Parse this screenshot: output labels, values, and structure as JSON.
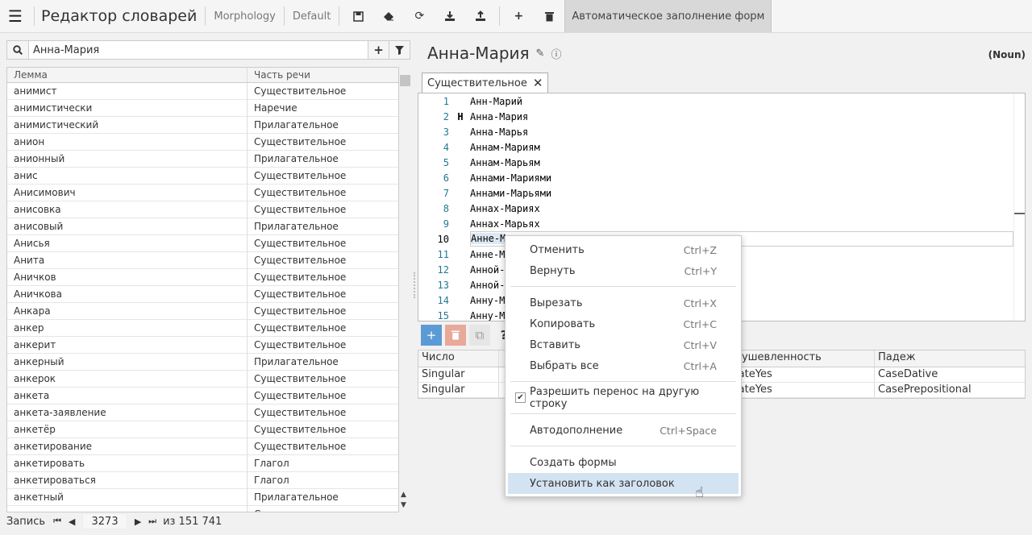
{
  "toolbar": {
    "app_title": "Редактор словарей",
    "module": "Morphology",
    "profile": "Default",
    "autofill_label": "Автоматическое заполнение форм"
  },
  "search": {
    "value": "Анна-Мария"
  },
  "left_table": {
    "columns": [
      "Лемма",
      "Часть речи"
    ],
    "rows": [
      [
        "анимист",
        "Существительное"
      ],
      [
        "анимистически",
        "Наречие"
      ],
      [
        "анимистический",
        "Прилагательное"
      ],
      [
        "анион",
        "Существительное"
      ],
      [
        "анионный",
        "Прилагательное"
      ],
      [
        "анис",
        "Существительное"
      ],
      [
        "Анисимович",
        "Существительное"
      ],
      [
        "анисовка",
        "Существительное"
      ],
      [
        "анисовый",
        "Прилагательное"
      ],
      [
        "Анисья",
        "Существительное"
      ],
      [
        "Анита",
        "Существительное"
      ],
      [
        "Аничков",
        "Существительное"
      ],
      [
        "Аничкова",
        "Существительное"
      ],
      [
        "Анкара",
        "Существительное"
      ],
      [
        "анкер",
        "Существительное"
      ],
      [
        "анкерит",
        "Существительное"
      ],
      [
        "анкерный",
        "Прилагательное"
      ],
      [
        "анкерок",
        "Существительное"
      ],
      [
        "анкета",
        "Существительное"
      ],
      [
        "анкета-заявление",
        "Существительное"
      ],
      [
        "анкетёр",
        "Существительное"
      ],
      [
        "анкетирование",
        "Существительное"
      ],
      [
        "анкетировать",
        "Глагол"
      ],
      [
        "анкетироваться",
        "Глагол"
      ],
      [
        "анкетный",
        "Прилагательное"
      ],
      [
        "анкетчик",
        "Существительное"
      ]
    ]
  },
  "pager": {
    "label": "Запись",
    "current": "3273",
    "total": "из 151 741"
  },
  "entry": {
    "title": "Анна-Мария",
    "pos_badge": "(Noun)",
    "tab": "Существительное"
  },
  "editor": {
    "lines": [
      {
        "n": "1",
        "m": "",
        "t": "Анн-Марий"
      },
      {
        "n": "2",
        "m": "H",
        "t": "Анна-Мария"
      },
      {
        "n": "3",
        "m": "",
        "t": "Анна-Марья"
      },
      {
        "n": "4",
        "m": "",
        "t": "Аннам-Мариям"
      },
      {
        "n": "5",
        "m": "",
        "t": "Аннам-Марьям"
      },
      {
        "n": "6",
        "m": "",
        "t": "Аннами-Мариями"
      },
      {
        "n": "7",
        "m": "",
        "t": "Аннами-Марьями"
      },
      {
        "n": "8",
        "m": "",
        "t": "Аннах-Мариях"
      },
      {
        "n": "9",
        "m": "",
        "t": "Аннах-Марьях"
      },
      {
        "n": "10",
        "m": "",
        "t": "Анне-М"
      },
      {
        "n": "11",
        "m": "",
        "t": "Анне-М"
      },
      {
        "n": "12",
        "m": "",
        "t": "Анной-"
      },
      {
        "n": "13",
        "m": "",
        "t": "Анной-"
      },
      {
        "n": "14",
        "m": "",
        "t": "Анну-М"
      },
      {
        "n": "15",
        "m": "",
        "t": "Анну-М"
      }
    ]
  },
  "grammar_table": {
    "columns": [
      "Число",
      "",
      "одушевленность",
      "Падеж"
    ],
    "rows": [
      [
        "Singular",
        "",
        "mateYes",
        "CaseDative"
      ],
      [
        "Singular",
        "",
        "mateYes",
        "CasePrepositional"
      ]
    ]
  },
  "context_menu": {
    "undo": {
      "label": "Отменить",
      "key": "Ctrl+Z"
    },
    "redo": {
      "label": "Вернуть",
      "key": "Ctrl+Y"
    },
    "cut": {
      "label": "Вырезать",
      "key": "Ctrl+X"
    },
    "copy": {
      "label": "Копировать",
      "key": "Ctrl+C"
    },
    "paste": {
      "label": "Вставить",
      "key": "Ctrl+V"
    },
    "select_all": {
      "label": "Выбрать все",
      "key": "Ctrl+A"
    },
    "wrap": {
      "label": "Разрешить перенос на другую строку"
    },
    "autocomplete": {
      "label": "Автодополнение",
      "key": "Ctrl+Space"
    },
    "create_forms": {
      "label": "Создать формы"
    },
    "set_heading": {
      "label": "Установить как заголовок"
    }
  },
  "colors": {
    "accent": "#5b9bd5",
    "delete": "#e8a89a",
    "menu_highlight": "#d4e3f2"
  }
}
